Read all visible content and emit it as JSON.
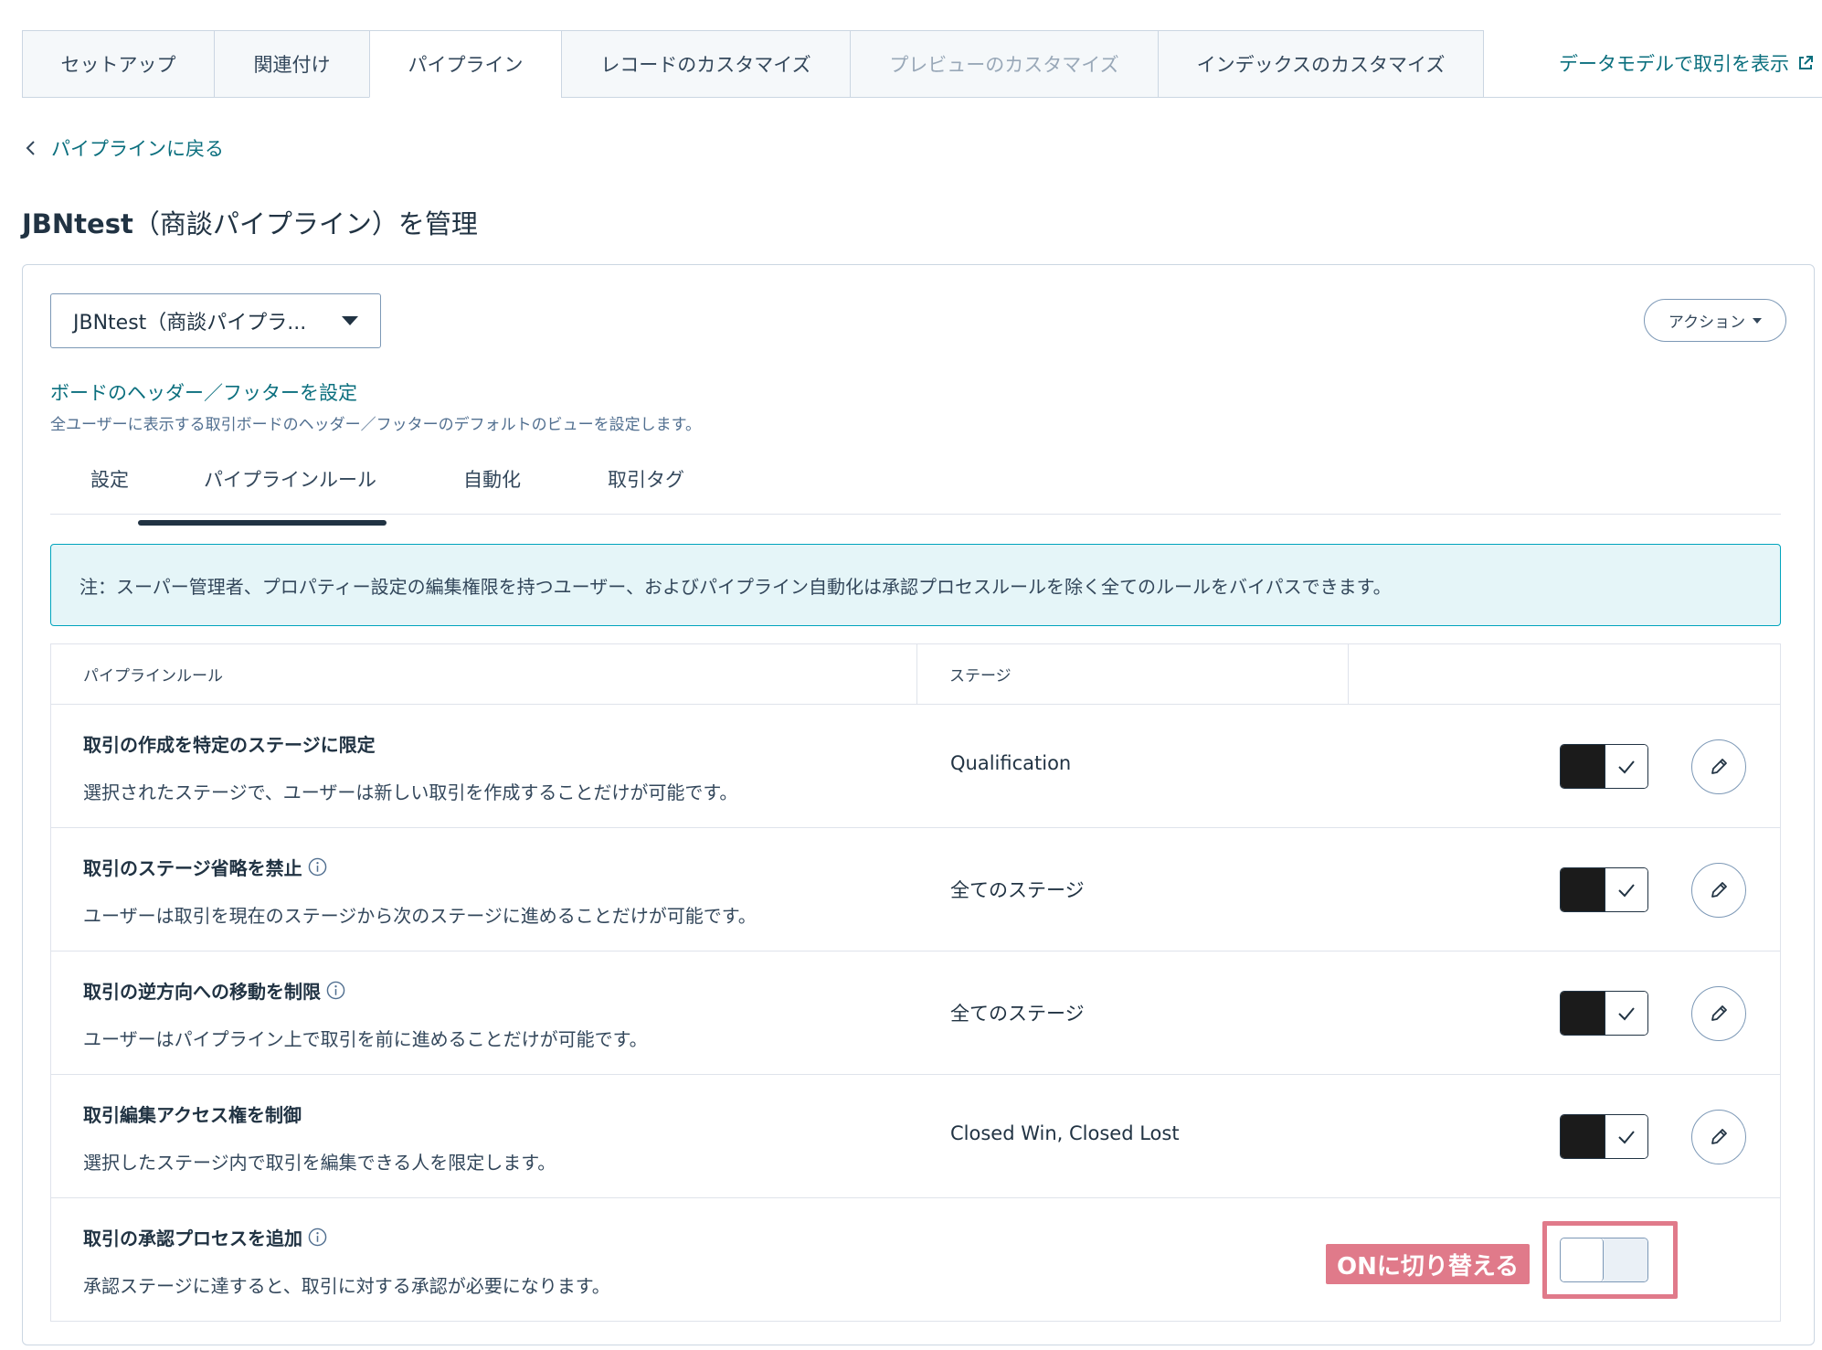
{
  "top_tabs": [
    {
      "label": "セットアップ",
      "state": "normal"
    },
    {
      "label": "関連付け",
      "state": "normal"
    },
    {
      "label": "パイプライン",
      "state": "active"
    },
    {
      "label": "レコードのカスタマイズ",
      "state": "normal"
    },
    {
      "label": "プレビューのカスタマイズ",
      "state": "disabled"
    },
    {
      "label": "インデックスのカスタマイズ",
      "state": "normal"
    }
  ],
  "data_model_link": "データモデルで取引を表示",
  "back_link": "パイプラインに戻る",
  "page_title": {
    "bold": "JBNtest",
    "rest": "（商談パイプライン）を管理"
  },
  "pipeline_select": {
    "value": "JBNtest（商談パイプラ..."
  },
  "actions_button": "アクション",
  "board_settings": {
    "link": "ボードのヘッダー／フッターを設定",
    "description": "全ユーザーに表示する取引ボードのヘッダー／フッターのデフォルトのビューを設定します。"
  },
  "sub_tabs": [
    {
      "label": "設定"
    },
    {
      "label": "パイプラインルール",
      "active": true
    },
    {
      "label": "自動化"
    },
    {
      "label": "取引タグ"
    }
  ],
  "note": "注：スーパー管理者、プロパティー設定の編集権限を持つユーザー、およびパイプライン自動化は承認プロセスルールを除く全てのルールをバイパスできます。",
  "table": {
    "headers": [
      "パイプラインルール",
      "ステージ",
      ""
    ],
    "rows": [
      {
        "name": "取引の作成を特定のステージに限定",
        "info": false,
        "description": "選択されたステージで、ユーザーは新しい取引を作成することだけが可能です。",
        "stage": "Qualification",
        "enabled": true
      },
      {
        "name": "取引のステージ省略を禁止",
        "info": true,
        "description": "ユーザーは取引を現在のステージから次のステージに進めることだけが可能です。",
        "stage": "全てのステージ",
        "enabled": true
      },
      {
        "name": "取引の逆方向への移動を制限",
        "info": true,
        "description": "ユーザーはパイプライン上で取引を前に進めることだけが可能です。",
        "stage": "全てのステージ",
        "enabled": true
      },
      {
        "name": "取引編集アクセス権を制御",
        "info": false,
        "description": "選択したステージ内で取引を編集できる人を限定します。",
        "stage": "Closed Win,  Closed Lost",
        "enabled": true
      },
      {
        "name": "取引の承認プロセスを追加",
        "info": true,
        "description": "承認ステージに達すると、取引に対する承認が必要になります。",
        "stage": "",
        "enabled": false
      }
    ]
  },
  "annotation": {
    "callout": "ONに切り替える",
    "color": "#e07a8a"
  },
  "colors": {
    "link": "#0b6f7e",
    "toggle_on": "#1b1b1b",
    "note_bg": "#e5f5f8",
    "note_border": "#00a4bd"
  }
}
